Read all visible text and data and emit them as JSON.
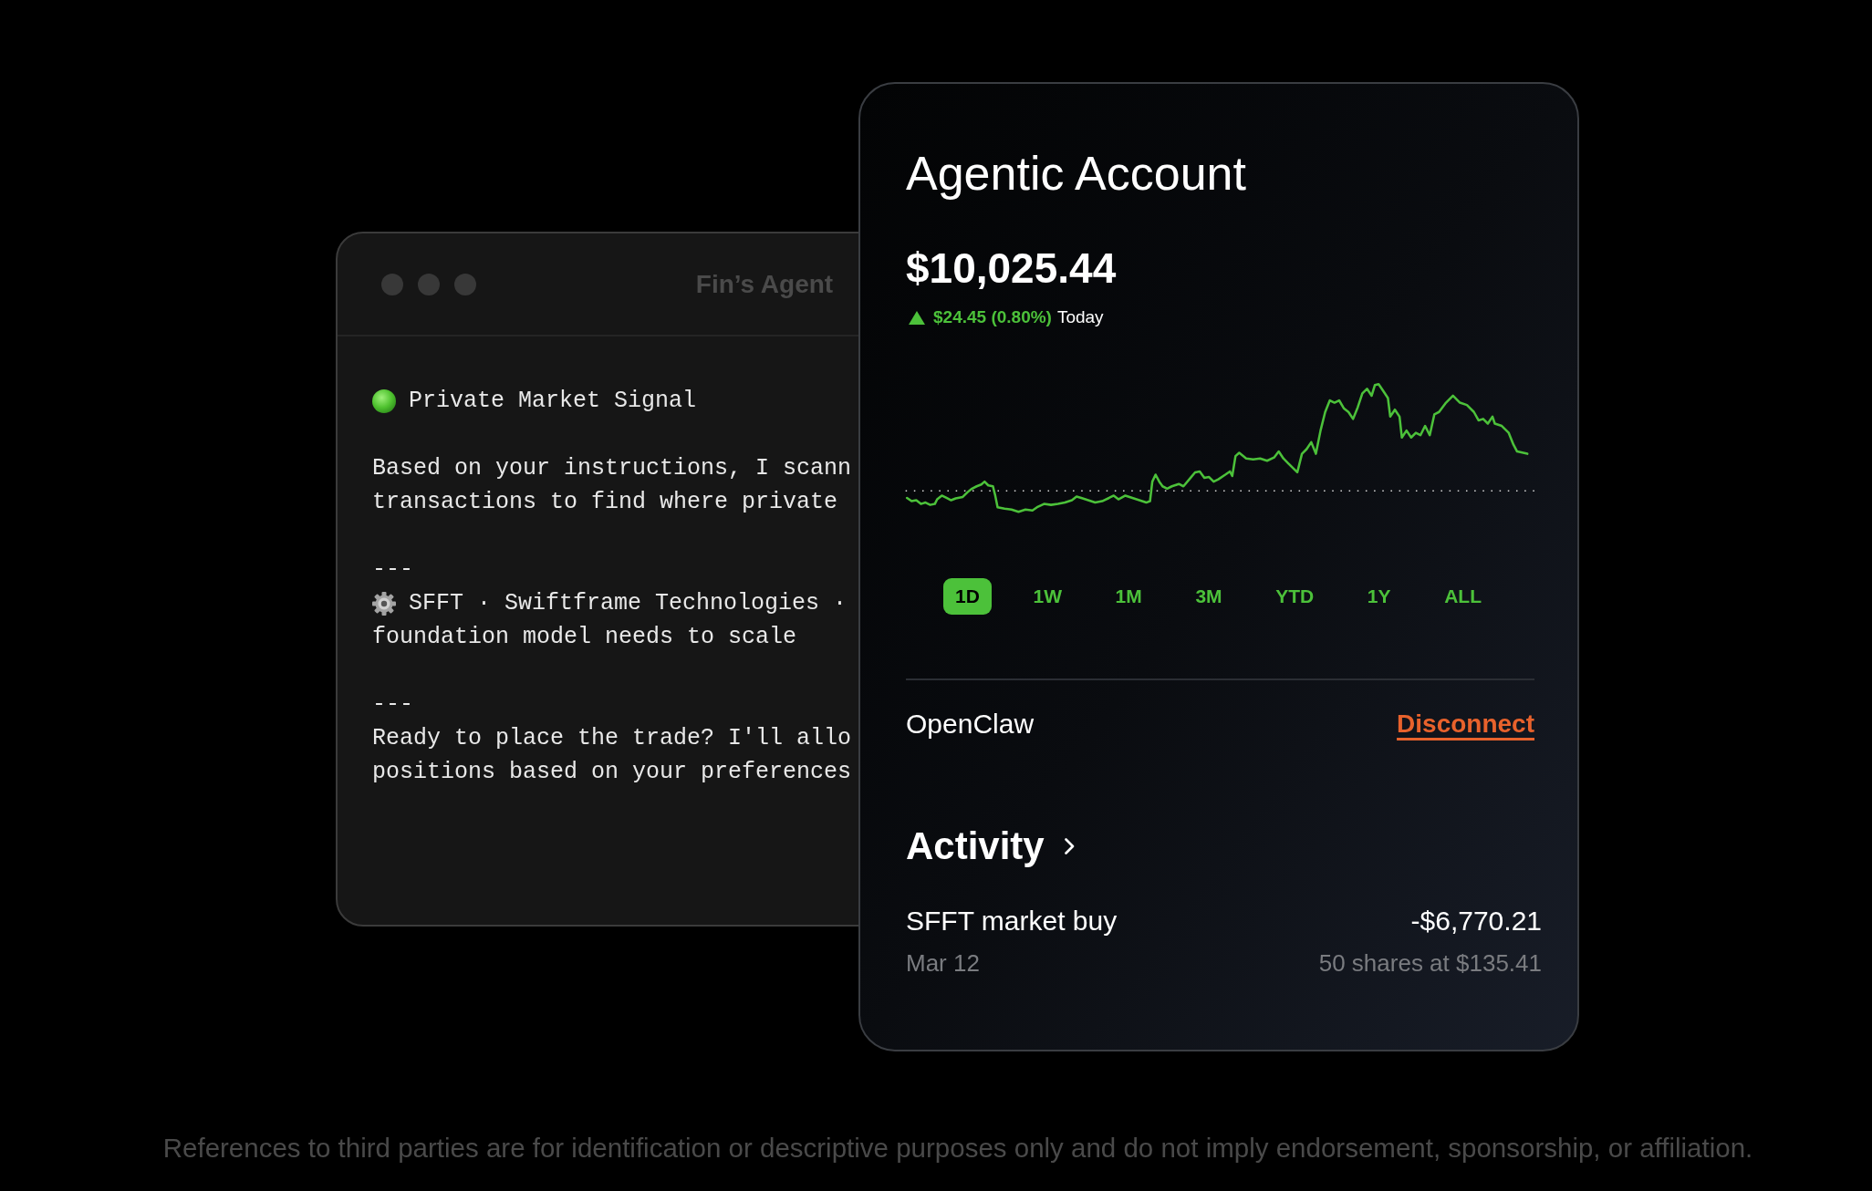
{
  "agent_window": {
    "title": "Fin’s Agent",
    "signal": {
      "title": "Private Market Signal"
    },
    "sections": [
      {
        "lines": [
          {
            "kind": "plain",
            "text": "Based on your instructions, I scann"
          },
          {
            "kind": "plain",
            "text": "transactions to find where private"
          }
        ]
      },
      {
        "lines": [
          {
            "kind": "rule",
            "text": "---"
          },
          {
            "kind": "ticker",
            "text": "SFFT · Swiftframe Technologies ·"
          },
          {
            "kind": "plain",
            "text": "foundation model needs to scale"
          }
        ]
      },
      {
        "lines": [
          {
            "kind": "rule",
            "text": "---"
          },
          {
            "kind": "plain",
            "text": "Ready to place the trade? I'll allo"
          },
          {
            "kind": "plain",
            "text": "positions based on your preferences"
          }
        ]
      }
    ]
  },
  "account_card": {
    "title": "Agentic Account",
    "balance": "$10,025.44",
    "change": {
      "gain": true,
      "amount": "$24.45 (0.80%)",
      "period": "Today"
    },
    "ranges": [
      {
        "label": "1D",
        "selected": true
      },
      {
        "label": "1W",
        "selected": false
      },
      {
        "label": "1M",
        "selected": false
      },
      {
        "label": "3M",
        "selected": false
      },
      {
        "label": "YTD",
        "selected": false
      },
      {
        "label": "1Y",
        "selected": false
      },
      {
        "label": "ALL",
        "selected": false
      }
    ],
    "connection": {
      "name": "OpenClaw",
      "action": "Disconnect"
    },
    "activity": {
      "title": "Activity",
      "items": [
        {
          "title": "SFFT market buy",
          "amount": "-$6,770.21",
          "date": "Mar 12",
          "detail": "50 shares at $135.41"
        }
      ]
    }
  },
  "disclaimer": "References to third parties are for identification or descriptive purposes only and do not imply endorsement, sponsorship, or affiliation."
}
